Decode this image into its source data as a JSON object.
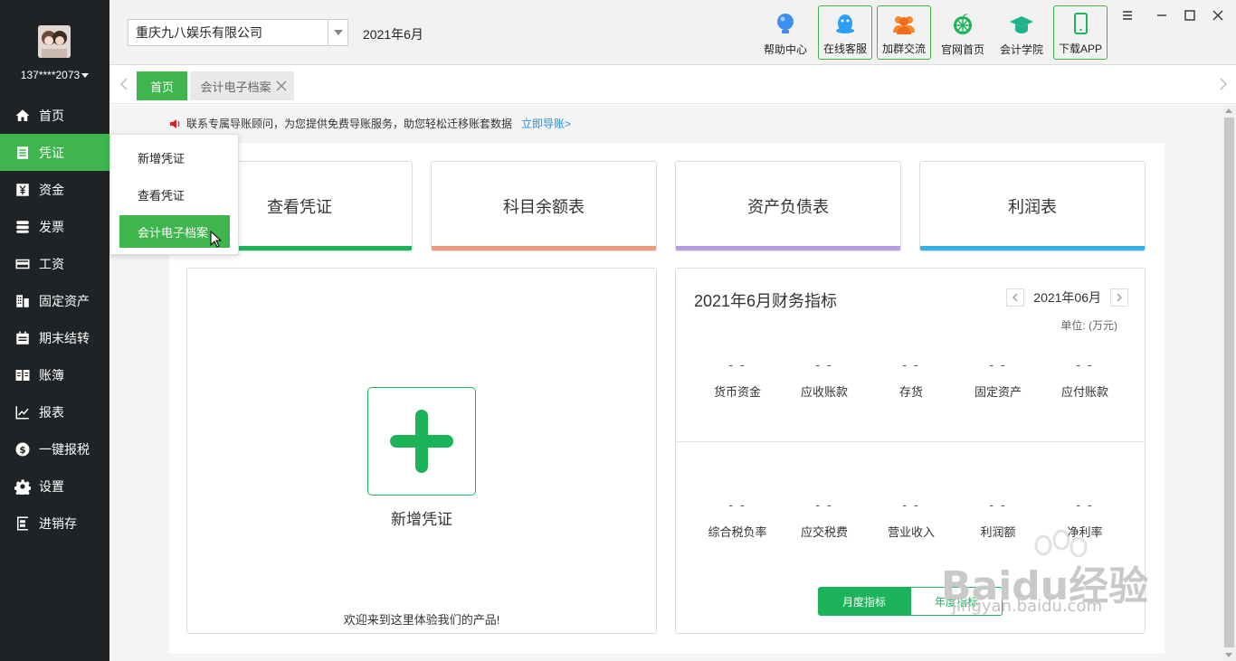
{
  "sidebar": {
    "user_phone": "137****2073",
    "items": [
      {
        "label": "首页",
        "icon": "home-icon"
      },
      {
        "label": "凭证",
        "icon": "voucher-icon",
        "active": true
      },
      {
        "label": "资金",
        "icon": "yen-icon"
      },
      {
        "label": "发票",
        "icon": "invoice-icon"
      },
      {
        "label": "工资",
        "icon": "salary-card-icon"
      },
      {
        "label": "固定资产",
        "icon": "building-icon"
      },
      {
        "label": "期末结转",
        "icon": "calendar-icon"
      },
      {
        "label": "账簿",
        "icon": "ledger-book-icon"
      },
      {
        "label": "报表",
        "icon": "chart-line-icon"
      },
      {
        "label": "一键报税",
        "icon": "dollar-circle-icon"
      },
      {
        "label": "设置",
        "icon": "gear-icon"
      },
      {
        "label": "进销存",
        "icon": "inventory-icon"
      }
    ]
  },
  "topbar": {
    "company": "重庆九八娱乐有限公司",
    "period": "2021年6月",
    "tools": [
      {
        "label": "帮助中心",
        "icon": "lightbulb-icon",
        "boxed": false
      },
      {
        "label": "在线客服",
        "icon": "qq-penguin-icon",
        "boxed": true
      },
      {
        "label": "加群交流",
        "icon": "group-icon",
        "boxed": true
      },
      {
        "label": "官网首页",
        "icon": "lime-logo-icon",
        "boxed": false
      },
      {
        "label": "会计学院",
        "icon": "graduation-cap-icon",
        "boxed": false
      },
      {
        "label": "下载APP",
        "icon": "mobile-phone-icon",
        "boxed": true
      }
    ]
  },
  "tabs": [
    {
      "label": "首页",
      "active": true
    },
    {
      "label": "会计电子档案",
      "active": false
    }
  ],
  "notice": {
    "text": "联系专属导账顾问，为您提供免费导账服务，助您轻松迁移账套数据",
    "link": "立即导账>"
  },
  "quick_cards": [
    {
      "label": "查看凭证",
      "color": "#1db35b"
    },
    {
      "label": "科目余额表",
      "color": "#ee9c7e"
    },
    {
      "label": "资产负债表",
      "color": "#b89be0"
    },
    {
      "label": "利润表",
      "color": "#33b2e6"
    }
  ],
  "add_voucher": {
    "label": "新增凭证",
    "welcome": "欢迎来到这里体验我们的产品!"
  },
  "financial": {
    "title": "2021年6月财务指标",
    "month": "2021年06月",
    "unit": "单位:   (万元)",
    "row1": [
      {
        "label": "货币资金",
        "value": "- -"
      },
      {
        "label": "应收账款",
        "value": "- -"
      },
      {
        "label": "存货",
        "value": "- -"
      },
      {
        "label": "固定资产",
        "value": "- -"
      },
      {
        "label": "应付账款",
        "value": "- -"
      }
    ],
    "row2": [
      {
        "label": "综合税负率",
        "value": "- -"
      },
      {
        "label": "应交税费",
        "value": "- -"
      },
      {
        "label": "营业收入",
        "value": "- -"
      },
      {
        "label": "利润额",
        "value": "- -"
      },
      {
        "label": "净利率",
        "value": "- -"
      }
    ],
    "toggle": {
      "monthly": "月度指标",
      "yearly": "年度指标"
    }
  },
  "dropdown": {
    "items": [
      {
        "label": "新增凭证",
        "active": false
      },
      {
        "label": "查看凭证",
        "active": false
      },
      {
        "label": "会计电子档案",
        "active": true
      }
    ]
  },
  "watermark": {
    "text": "Baidu经验",
    "url": "jingyan.baidu.com"
  },
  "colors": {
    "accent": "#3eb54d",
    "sidebar": "#1f2326"
  }
}
